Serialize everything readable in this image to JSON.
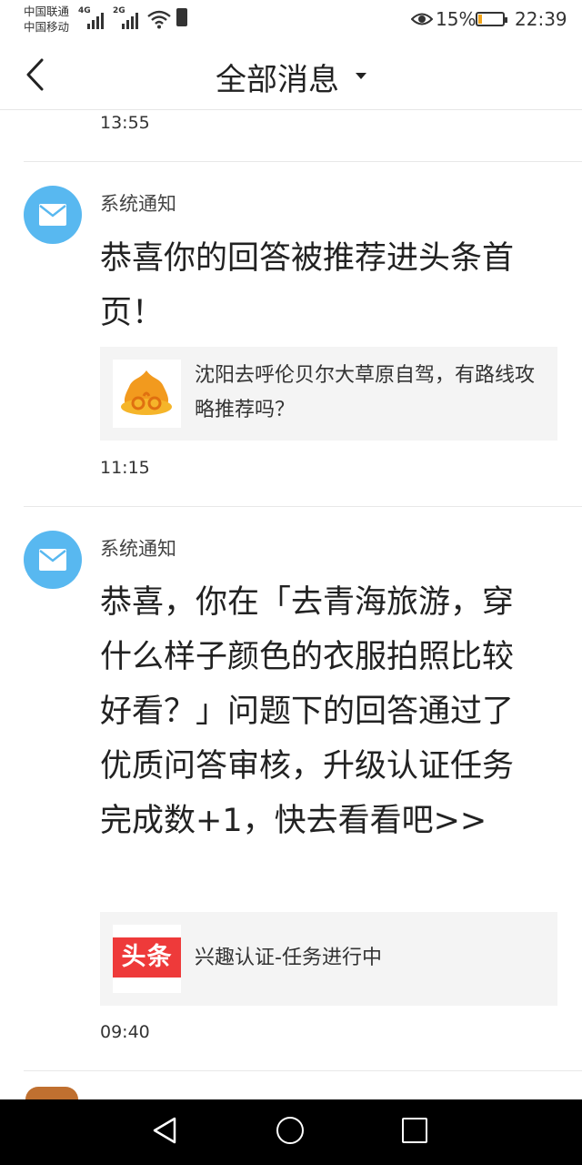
{
  "status_bar": {
    "carrier_1": "中国联通",
    "carrier_2": "中国移动",
    "net_1": "4G",
    "net_2": "2G",
    "battery_percent": "15%",
    "battery_level": 0.15,
    "time": "22:39",
    "icons": [
      "signal-icon",
      "wifi-icon",
      "sim-icon",
      "eye-icon",
      "battery-icon"
    ]
  },
  "nav": {
    "title": "全部消息",
    "back_icon": "chevron-left-icon",
    "dropdown_icon": "caret-down-icon"
  },
  "top_time": "13:55",
  "messages": [
    {
      "sender": "系统通知",
      "text": "恭喜你的回答被推荐进头条首页！",
      "card_text": "沈阳去呼伦贝尔大草原自驾，有路线攻略推荐吗？",
      "time": "11:15"
    },
    {
      "sender": "系统通知",
      "text": "恭喜，你在「去青海旅游，穿什么样子颜色的衣服拍照比较好看？」问题下的回答通过了优质问答审核，升级认证任务完成数+1，快去看看吧>>",
      "card_text": "兴趣认证-任务进行中",
      "card_logo_text": "头条",
      "time": "09:40"
    }
  ],
  "colors": {
    "avatar_blue": "#58b8f0",
    "toutiao_red": "#ee3a3a",
    "card_bg": "#f4f4f4"
  }
}
